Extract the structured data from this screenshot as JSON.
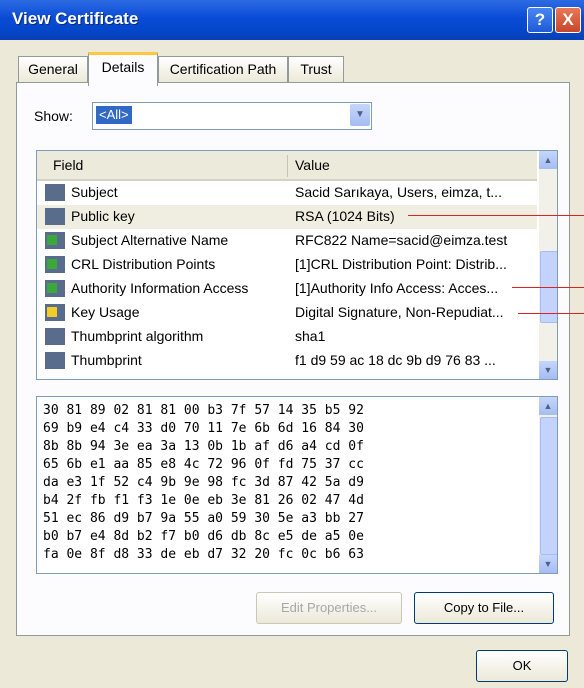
{
  "window": {
    "title": "View Certificate",
    "help_label": "?",
    "close_label": "X"
  },
  "tabs": [
    "General",
    "Details",
    "Certification Path",
    "Trust"
  ],
  "show": {
    "label": "Show:",
    "value": "<All>"
  },
  "list": {
    "headers": {
      "field": "Field",
      "value": "Value"
    },
    "rows": [
      {
        "icon": "certificate-field-icon",
        "field": "Subject",
        "value": "Sacid Sarıkaya, Users, eimza, t..."
      },
      {
        "icon": "certificate-field-icon",
        "field": "Public key",
        "value": "RSA (1024 Bits)"
      },
      {
        "icon": "extension-icon",
        "field": "Subject Alternative Name",
        "value": "RFC822 Name=sacid@eimza.test"
      },
      {
        "icon": "extension-icon",
        "field": "CRL Distribution Points",
        "value": "[1]CRL Distribution Point: Distrib..."
      },
      {
        "icon": "extension-icon",
        "field": "Authority Information Access",
        "value": "[1]Authority Info Access: Acces..."
      },
      {
        "icon": "critical-extension-icon",
        "field": "Key Usage",
        "value": "Digital Signature, Non-Repudiat..."
      },
      {
        "icon": "property-icon",
        "field": "Thumbprint algorithm",
        "value": "sha1"
      },
      {
        "icon": "property-icon",
        "field": "Thumbprint",
        "value": "f1 d9 59 ac 18 dc 9b d9 76 83 ..."
      }
    ]
  },
  "hex_lines": [
    "30 81 89 02 81 81 00 b3 7f 57 14 35 b5 92",
    "69 b9 e4 c4 33 d0 70 11 7e 6b 6d 16 84 30",
    "8b 8b 94 3e ea 3a 13 0b 1b af d6 a4 cd 0f",
    "65 6b e1 aa 85 e8 4c 72 96 0f fd 75 37 cc",
    "da e3 1f 52 c4 9b 9e 98 fc 3d 87 42 5a d9",
    "b4 2f fb f1 f3 1e 0e eb 3e 81 26 02 47 4d",
    "51 ec 86 d9 b7 9a 55 a0 59 30 5e a3 bb 27",
    "b0 b7 e4 8d b2 f7 b0 d6 db 8c e5 de a5 0e",
    "fa 0e 8f d8 33 de eb d7 32 20 fc 0c b6 63"
  ],
  "buttons": {
    "edit_properties": "Edit Properties...",
    "copy_to_file": "Copy to File...",
    "ok": "OK"
  }
}
